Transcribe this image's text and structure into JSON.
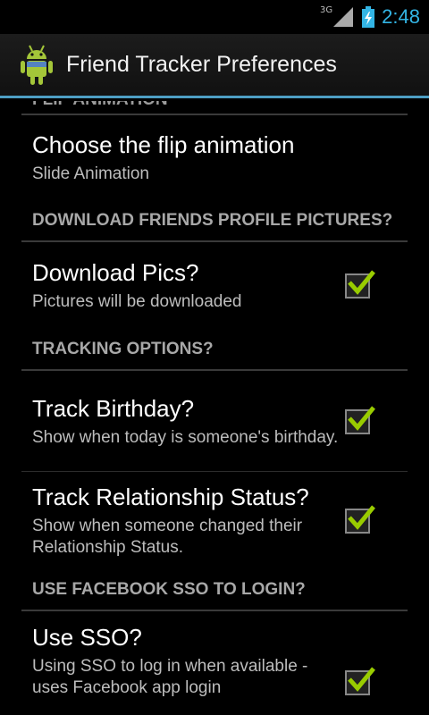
{
  "status_bar": {
    "network_type": "3G",
    "time": "2:48",
    "icons": [
      "signal-icon",
      "battery-charging-icon"
    ]
  },
  "action_bar": {
    "title": "Friend Tracker Preferences",
    "icon": "android-icon"
  },
  "scrolled_header": "FLIP ANIMATION",
  "sections": [
    {
      "preferences": [
        {
          "title": "Choose the flip animation",
          "summary": "Slide Animation"
        }
      ]
    },
    {
      "header": "DOWNLOAD FRIENDS PROFILE PICTURES?",
      "preferences": [
        {
          "title": "Download Pics?",
          "summary": "Pictures will be downloaded",
          "checked": true
        }
      ]
    },
    {
      "header": "TRACKING OPTIONS?",
      "preferences": [
        {
          "title": "Track Birthday?",
          "summary": "Show when today is someone's birthday.",
          "checked": true
        },
        {
          "title": "Track Relationship Status?",
          "summary": "Show when someone changed their Relationship Status.",
          "checked": true
        }
      ]
    },
    {
      "header": "USE FACEBOOK SSO TO LOGIN?",
      "preferences": [
        {
          "title": "Use SSO?",
          "summary": "Using SSO to log in when available - uses Facebook app login",
          "checked": true
        }
      ]
    }
  ],
  "colors": {
    "accent": "#33b5e5",
    "checkmark": "#99cc00",
    "divider": "#4d9ec3"
  }
}
